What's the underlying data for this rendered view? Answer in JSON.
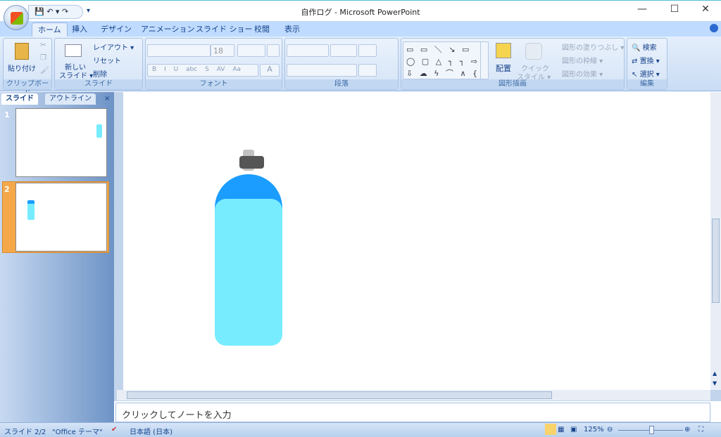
{
  "window": {
    "title": "自作ログ - Microsoft PowerPoint",
    "minimize": "—",
    "maximize": "☐",
    "close": "✕"
  },
  "qat": {
    "save": "💾",
    "undo": "↶ ▾",
    "redo": "↷",
    "customize": "▾"
  },
  "tabs": [
    "ホーム",
    "挿入",
    "デザイン",
    "アニメーション",
    "スライド ショー",
    "校閲",
    "表示"
  ],
  "ribbon": {
    "clipboard": {
      "label": "クリップボード",
      "paste": "貼り付け"
    },
    "slides": {
      "label": "スライド",
      "new_slide": "新しい",
      "new_slide2": "スライド ▾",
      "layout": "レイアウト ▾",
      "reset": "リセット",
      "delete": "削除"
    },
    "font": {
      "label": "フォント",
      "font_name": "",
      "font_size": "18",
      "bold": "B",
      "italic": "I",
      "underline": "U",
      "strike": "abc",
      "shadow": "S",
      "spacing": "AV",
      "case": "Aa",
      "color": "A"
    },
    "paragraph": {
      "label": "段落"
    },
    "drawing": {
      "label": "図形描画",
      "arrange": "配置",
      "quick_style": "クイック",
      "quick_style2": "スタイル ▾",
      "fill": "図形の塗りつぶし ▾",
      "outline": "図形の枠線 ▾",
      "effects": "図形の効果 ▾",
      "shapes": "▭ ▭ ＼ ↘ ▭ ◯ ▢ △ ┐ ┐ ⇨ ⇩ ☁ ϟ ⌒ ∧ { }"
    },
    "editing": {
      "label": "編集",
      "find": "検索",
      "replace": "置換 ▾",
      "select": "選択 ▾"
    }
  },
  "panel": {
    "tab_slides": "スライド",
    "tab_outline": "アウトライン",
    "close": "×",
    "slides": [
      {
        "num": "1"
      },
      {
        "num": "2",
        "selected": true
      }
    ]
  },
  "notes": {
    "placeholder": "クリックしてノートを入力"
  },
  "status": {
    "slide": "スライド 2/2",
    "theme": "\"Office テーマ\"",
    "language": "日本語 (日本)",
    "zoom": "125%",
    "zoom_level": 0.5
  },
  "colors": {
    "bottle_dome": "#1a9dff",
    "bottle_body": "#77ecff",
    "cap": "#555555",
    "neck": "#c0c0c0",
    "selected_thumb": "#f5a84a"
  }
}
